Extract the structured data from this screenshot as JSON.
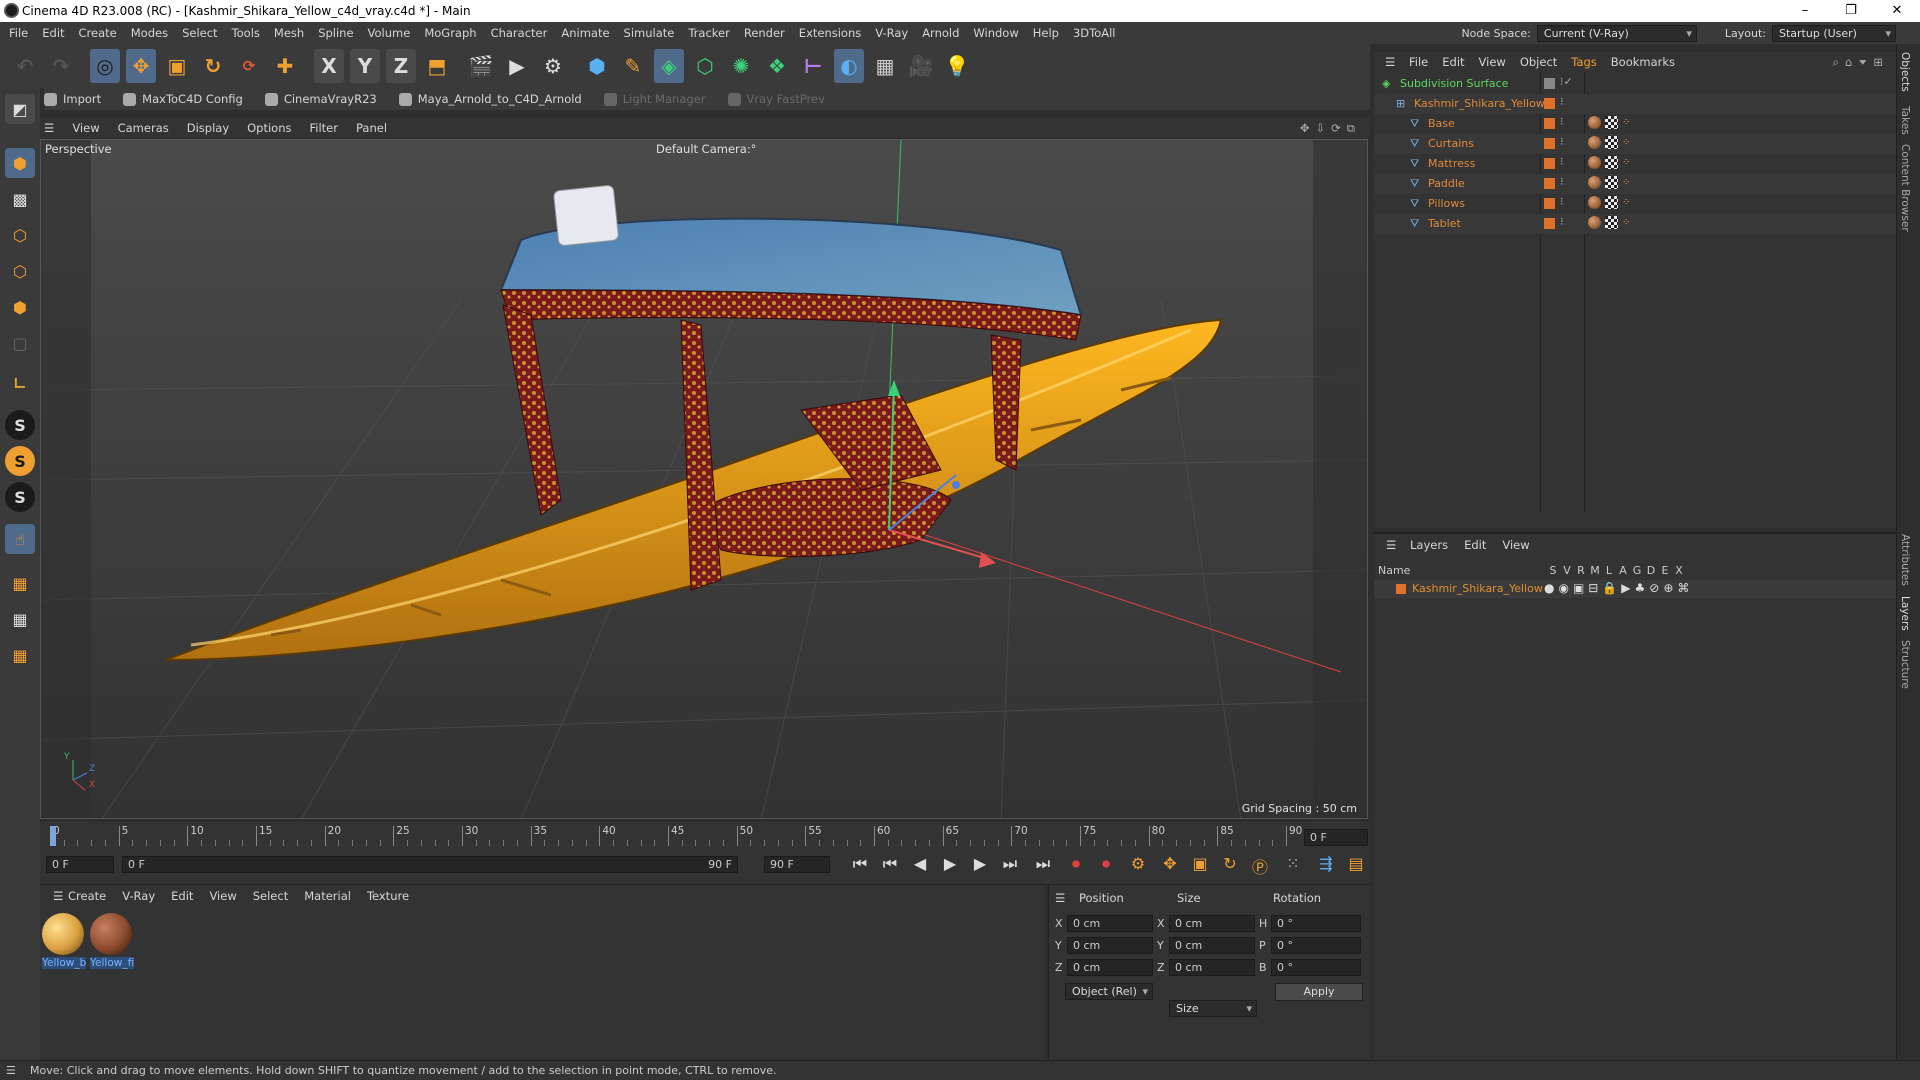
{
  "window": {
    "title": "Cinema 4D R23.008 (RC) - [Kashmir_Shikara_Yellow_c4d_vray.c4d *] - Main"
  },
  "menu": [
    "File",
    "Edit",
    "Create",
    "Modes",
    "Select",
    "Tools",
    "Mesh",
    "Spline",
    "Volume",
    "MoGraph",
    "Character",
    "Animate",
    "Simulate",
    "Tracker",
    "Render",
    "Extensions",
    "V-Ray",
    "Arnold",
    "Window",
    "Help",
    "3DToAll"
  ],
  "node_space": {
    "label": "Node Space:",
    "value": "Current (V-Ray)"
  },
  "layout": {
    "label": "Layout:",
    "value": "Startup (User)"
  },
  "toolbar_icons": {
    "x": "X",
    "y": "Y",
    "z": "Z"
  },
  "plugins": [
    {
      "label": "Import",
      "enabled": true
    },
    {
      "label": "MaxToC4D Config",
      "enabled": true
    },
    {
      "label": "CinemaVrayR23",
      "enabled": true
    },
    {
      "label": "Maya_Arnold_to_C4D_Arnold",
      "enabled": true
    },
    {
      "label": "Light Manager",
      "enabled": false
    },
    {
      "label": "Vray FastPrev",
      "enabled": false
    }
  ],
  "viewport": {
    "menu": [
      "View",
      "Cameras",
      "Display",
      "Options",
      "Filter",
      "Panel"
    ],
    "label": "Perspective",
    "camera": "Default Camera",
    "camera_suffix": ":°",
    "grid_spacing": "Grid Spacing : 50 cm",
    "axis": {
      "y": "Y",
      "z": "Z",
      "x": "X"
    }
  },
  "timeline": {
    "ticks": [
      "0",
      "5",
      "10",
      "15",
      "20",
      "25",
      "30",
      "35",
      "40",
      "45",
      "50",
      "55",
      "60",
      "65",
      "70",
      "75",
      "80",
      "85",
      "90"
    ],
    "current_frame": "0 F",
    "start_field": "0 F",
    "range_start": "0 F",
    "range_end": "90 F",
    "end_field": "90 F"
  },
  "materials": {
    "menu": [
      "Create",
      "V-Ray",
      "Edit",
      "View",
      "Select",
      "Material",
      "Texture"
    ],
    "items": [
      {
        "name": "Yellow_b",
        "color": "#d9a040"
      },
      {
        "name": "Yellow_fi",
        "color": "#8b4a2f"
      }
    ]
  },
  "coords": {
    "headers": {
      "position": "Position",
      "size": "Size",
      "rotation": "Rotation"
    },
    "rows": [
      {
        "axis": "X",
        "pos": "0 cm",
        "size_axis": "X",
        "size": "0 cm",
        "rot_axis": "H",
        "rot": "0 °"
      },
      {
        "axis": "Y",
        "pos": "0 cm",
        "size_axis": "Y",
        "size": "0 cm",
        "rot_axis": "P",
        "rot": "0 °"
      },
      {
        "axis": "Z",
        "pos": "0 cm",
        "size_axis": "Z",
        "size": "0 cm",
        "rot_axis": "B",
        "rot": "0 °"
      }
    ],
    "mode": "Object (Rel)",
    "size_mode": "Size",
    "apply": "Apply"
  },
  "objects": {
    "menu": [
      "File",
      "Edit",
      "View",
      "Object",
      "Tags",
      "Bookmarks"
    ],
    "items": [
      {
        "name": "Subdivision Surface",
        "level": 0,
        "color": "#5fd75f"
      },
      {
        "name": "Kashmir_Shikara_Yellow",
        "level": 1,
        "color": "#e08a3a"
      },
      {
        "name": "Base",
        "level": 2,
        "color": "#e08a3a"
      },
      {
        "name": "Curtains",
        "level": 2,
        "color": "#e08a3a"
      },
      {
        "name": "Mattress",
        "level": 2,
        "color": "#e08a3a"
      },
      {
        "name": "Paddle",
        "level": 2,
        "color": "#e08a3a"
      },
      {
        "name": "Pillows",
        "level": 2,
        "color": "#e08a3a"
      },
      {
        "name": "Tablet",
        "level": 2,
        "color": "#e08a3a"
      }
    ]
  },
  "layers": {
    "menu": [
      "Layers",
      "Edit",
      "View"
    ],
    "columns": {
      "name": "Name",
      "flags": [
        "S",
        "V",
        "R",
        "M",
        "L",
        "A",
        "G",
        "D",
        "E",
        "X"
      ]
    },
    "items": [
      {
        "name": "Kashmir_Shikara_Yellow",
        "color": "#e0702a"
      }
    ]
  },
  "side_tabs": [
    "Objects",
    "Takes",
    "Content Browser",
    "Attributes",
    "Layers",
    "Structure"
  ],
  "status": "Move: Click and drag to move elements. Hold down SHIFT to quantize movement / add to the selection in point mode, CTRL to remove."
}
